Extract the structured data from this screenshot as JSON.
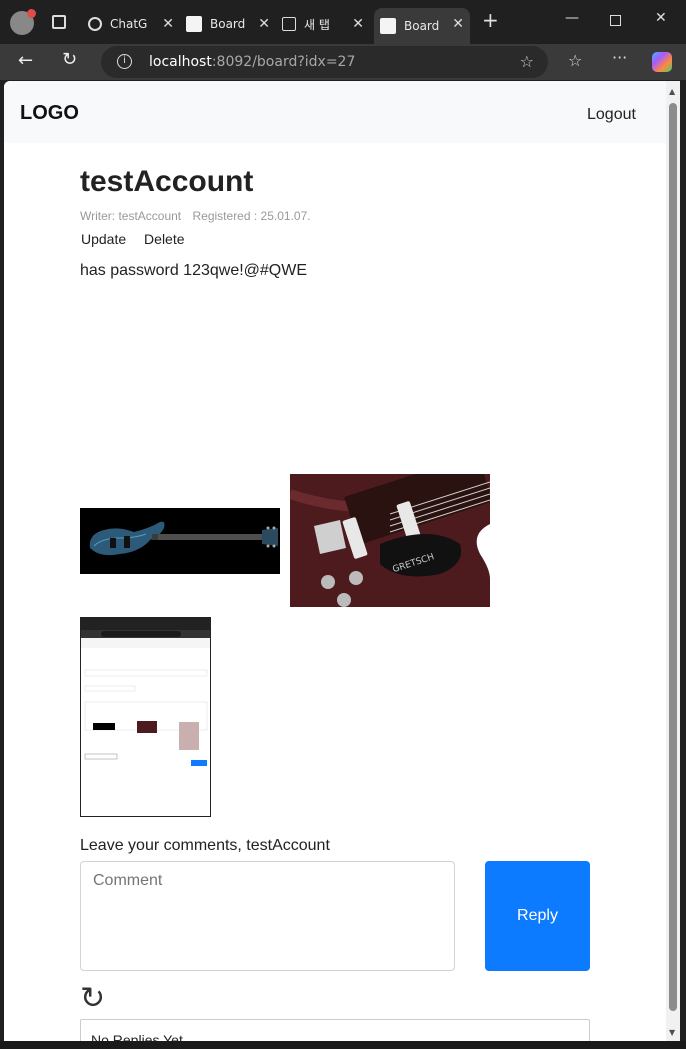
{
  "browser": {
    "tabs": [
      {
        "label": "ChatG"
      },
      {
        "label": "Board"
      },
      {
        "label": "새 탭"
      },
      {
        "label": "Board"
      }
    ],
    "url_host": "localhost",
    "url_path": ":8092/board?idx=27"
  },
  "nav": {
    "logo": "LOGO",
    "logout": "Logout"
  },
  "post": {
    "title": "testAccount",
    "writer": "Writer: testAccount",
    "registered": "Registered : 25.01.07.",
    "update": "Update",
    "delete": "Delete",
    "content": "has password 123qwe!@#QWE"
  },
  "comments": {
    "label": "Leave your comments, testAccount",
    "placeholder": "Comment",
    "reply_button": "Reply",
    "refresh_icon": "↻",
    "empty_text": "No Replies Yet"
  },
  "colors": {
    "accent": "#0d7bff",
    "navbar": "#f8f9fa"
  }
}
